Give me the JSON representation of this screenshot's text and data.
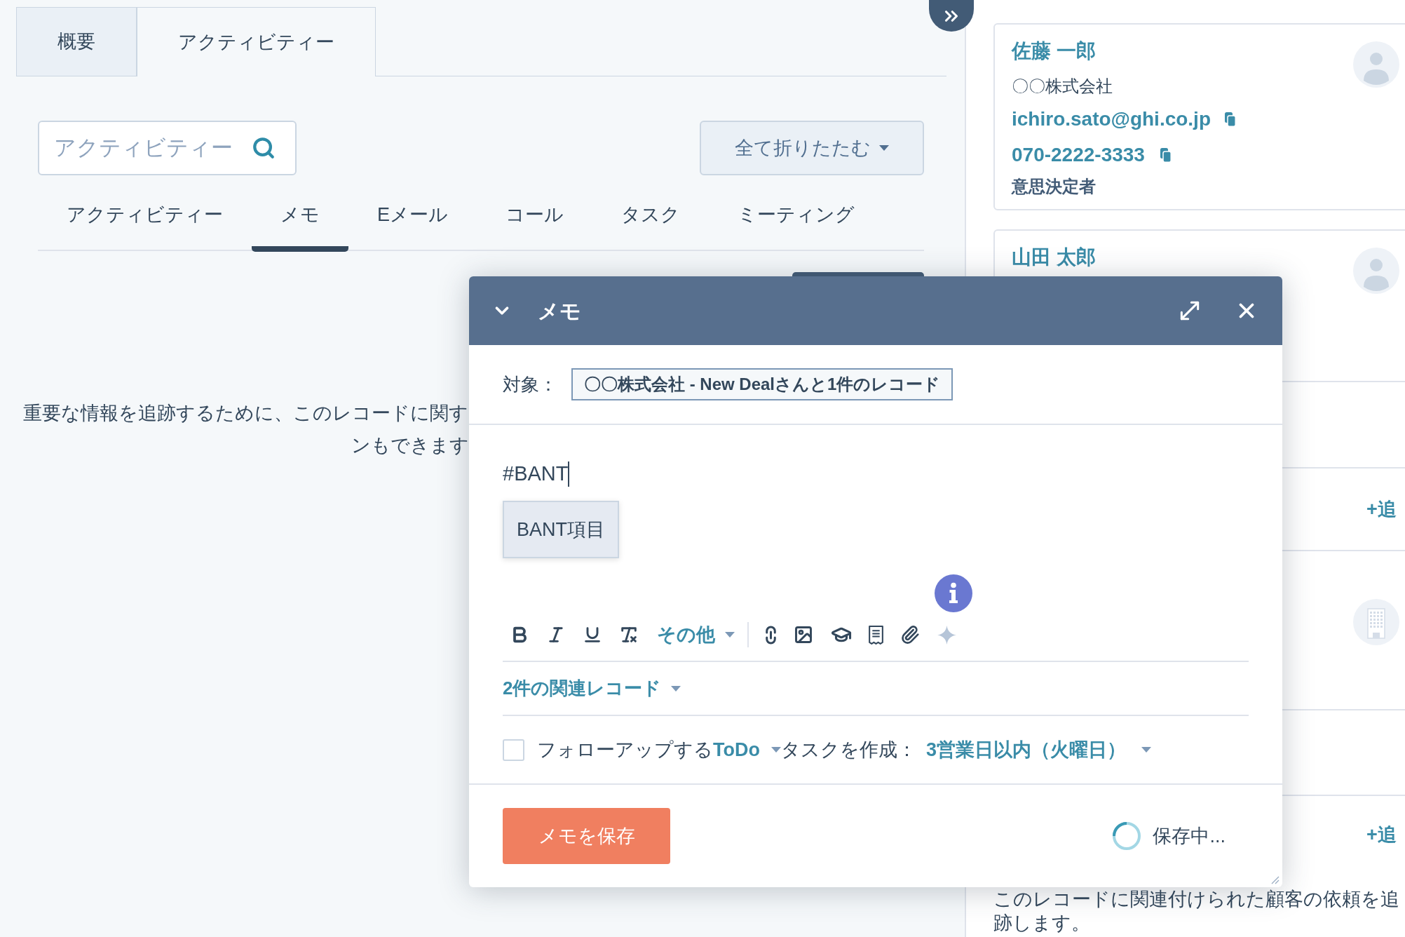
{
  "record_tabs": [
    {
      "label": "概要",
      "selected": false
    },
    {
      "label": "アクティビティー",
      "selected": true
    }
  ],
  "activity_search": {
    "placeholder": "アクティビティー"
  },
  "collapse_all_button": {
    "label": "全て折りたたむ"
  },
  "activity_filters": [
    {
      "label": "アクティビティー",
      "selected": false
    },
    {
      "label": "メモ",
      "selected": true
    },
    {
      "label": "Eメール",
      "selected": false
    },
    {
      "label": "コール",
      "selected": false
    },
    {
      "label": "タスク",
      "selected": false
    },
    {
      "label": "ミーティング",
      "selected": false
    }
  ],
  "empty_state": {
    "lines": [
      "重要な情報を追跡するために、このレコードに関す",
      "ンもできます"
    ]
  },
  "note_dialog": {
    "title": "メモ",
    "target": {
      "label": "対象：",
      "value": "〇〇株式会社 - New Dealさんと1件のレコード"
    },
    "body": "#BANT",
    "suggestions": [
      {
        "label": "BANT項目",
        "selected": true
      }
    ],
    "toolbar": {
      "more_label": "その他"
    },
    "associations": {
      "label": "2件の関連レコード"
    },
    "follow_up": {
      "checked": false,
      "prefix": "フォローアップする",
      "task_type": "ToDo",
      "middle": "タスクを作成：",
      "due": "3営業日以内（火曜日）"
    },
    "save_button": {
      "label": "メモを保存"
    },
    "status": {
      "label": "保存中..."
    }
  },
  "sidebar": {
    "contacts": [
      {
        "name": "佐藤 一郎",
        "company": "〇〇株式会社",
        "email": "ichiro.sato@ghi.co.jp",
        "phone": "070-2222-3333",
        "role": "意思決定者"
      },
      {
        "name": "山田 太郎"
      }
    ],
    "add_links": [
      "+追",
      "+追"
    ],
    "description": "このレコードに関連付けられた顧客の依頼を追跡します。"
  }
}
